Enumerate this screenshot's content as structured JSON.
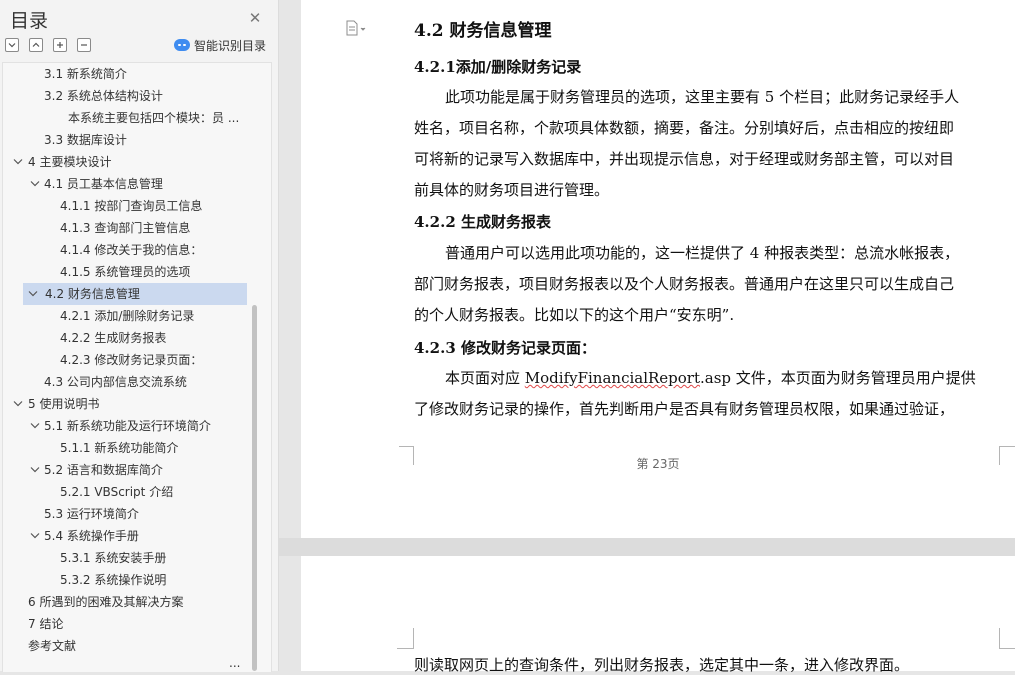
{
  "sidebar": {
    "title": "目录",
    "smart_toc_label": "智能识别目录",
    "toc": [
      {
        "label": "3.1 新系统简介",
        "level": 2
      },
      {
        "label": "3.2  系统总体结构设计",
        "level": 2
      },
      {
        "label": "本系统主要包括四个模块：员 ...",
        "level": 3
      },
      {
        "label": "3.3    数据库设计",
        "level": 2
      },
      {
        "label": "4  主要模块设计",
        "level": 1,
        "expanded": true
      },
      {
        "label": "4.1 员工基本信息管理",
        "level": 2,
        "expanded": true
      },
      {
        "label": "4.1.1    按部门查询员工信息",
        "level": 3
      },
      {
        "label": "4.1.3  查询部门主管信息",
        "level": 3
      },
      {
        "label": "4.1.4 修改关于我的信息：",
        "level": 3
      },
      {
        "label": "4.1.5  系统管理员的选项",
        "level": 3
      },
      {
        "label": "4.2  财务信息管理",
        "level": 2,
        "expanded": true,
        "selected": true
      },
      {
        "label": "4.2.1 添加/删除财务记录",
        "level": 3
      },
      {
        "label": "4.2.2  生成财务报表",
        "level": 3
      },
      {
        "label": "4.2.3  修改财务记录页面：",
        "level": 3
      },
      {
        "label": "4.3  公司内部信息交流系统",
        "level": 2
      },
      {
        "label": "5    使用说明书",
        "level": 1,
        "expanded": true
      },
      {
        "label": "5.1 新系统功能及运行环境简介",
        "level": 2,
        "expanded": true
      },
      {
        "label": "5.1.1  新系统功能简介",
        "level": 3
      },
      {
        "label": "5.2  语言和数据库简介",
        "level": 2,
        "expanded": true
      },
      {
        "label": "5.2.1 VBScript 介绍",
        "level": 3
      },
      {
        "label": "5.3  运行环境简介",
        "level": 2
      },
      {
        "label": "5.4 系统操作手册",
        "level": 2,
        "expanded": true
      },
      {
        "label": "5.3.1 系统安装手册",
        "level": 3
      },
      {
        "label": "5.3.2  系统操作说明",
        "level": 3
      },
      {
        "label": "6    所遇到的困难及其解决方案",
        "level": 1
      },
      {
        "label": "7  结论",
        "level": 1
      },
      {
        "label": "参考文献",
        "level": 1
      },
      {
        "label": "...",
        "level": 3
      }
    ]
  },
  "document": {
    "page1": {
      "h2": "4.2 财务信息管理",
      "s1_heading": "4.2.1添加/删除财务记录",
      "s1_lines": [
        "此项功能是属于财务管理员的选项，这里主要有 5 个栏目；此财务记录经手人",
        "姓名，项目名称，个款项具体数额，摘要，备注。分别填好后，点击相应的按纽即",
        "可将新的记录写入数据库中，并出现提示信息，对于经理或财务部主管，可以对目",
        "前具体的财务项目进行管理。"
      ],
      "s2_heading": "4.2.2 生成财务报表",
      "s2_lines": [
        "普通用户可以选用此项功能的，这一栏提供了 4 种报表类型：总流水帐报表，",
        "部门财务报表，项目财务报表以及个人财务报表。普通用户在这里只可以生成自己",
        "的个人财务报表。比如以下的这个用户“安东明”."
      ],
      "s3_heading": "4.2.3 修改财务记录页面：",
      "s3_line1_pre": "本页面对应 ",
      "s3_line1_file": "ModifyFinancialReport",
      "s3_line1_post": ".asp 文件，本页面为财务管理员用户提供",
      "s3_line2": "了修改财务记录的操作，首先判断用户是否具有财务管理员权限，如果通过验证，",
      "footer": "第 23页"
    },
    "page2": {
      "line1": "则读取网页上的查询条件，列出财务报表，选定其中一条，进入修改界面。"
    }
  }
}
